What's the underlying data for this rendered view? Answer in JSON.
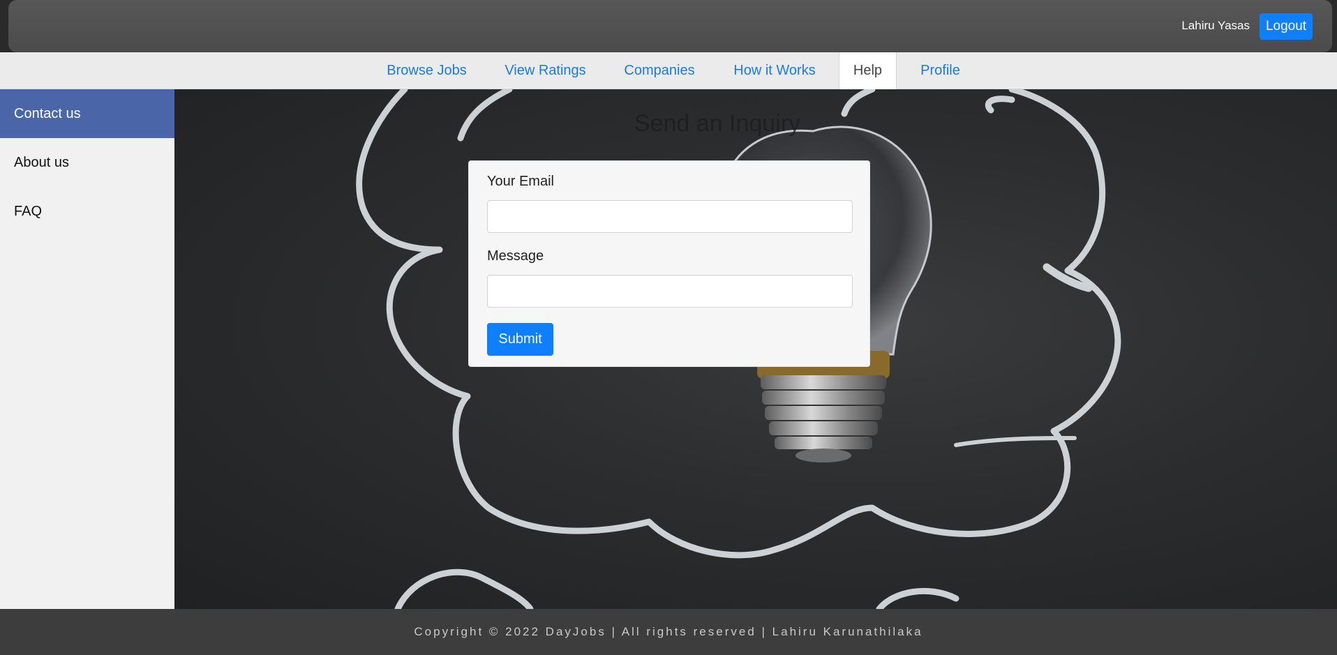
{
  "header": {
    "user_name": "Lahiru Yasas",
    "logout_label": "Logout"
  },
  "nav": {
    "items": [
      {
        "label": "Browse Jobs"
      },
      {
        "label": "View Ratings"
      },
      {
        "label": "Companies"
      },
      {
        "label": "How it Works"
      },
      {
        "label": "Help"
      },
      {
        "label": "Profile"
      }
    ],
    "active": "Help"
  },
  "sidebar": {
    "items": [
      {
        "label": "Contact us"
      },
      {
        "label": "About us"
      },
      {
        "label": "FAQ"
      }
    ],
    "active": "Contact us"
  },
  "main": {
    "title": "Send an Inquiry",
    "form": {
      "email_label": "Your Email",
      "email_value": "",
      "message_label": "Message",
      "message_value": "",
      "submit_label": "Submit"
    }
  },
  "footer": {
    "text": "Copyright © 2022 DayJobs | All rights reserved | Lahiru Karunathilaka"
  },
  "colors": {
    "accent": "#0d7fff",
    "sidebar_active": "#4a66a8",
    "nav_link": "#1a7ae6",
    "footer_bg": "#3d3d3d"
  }
}
